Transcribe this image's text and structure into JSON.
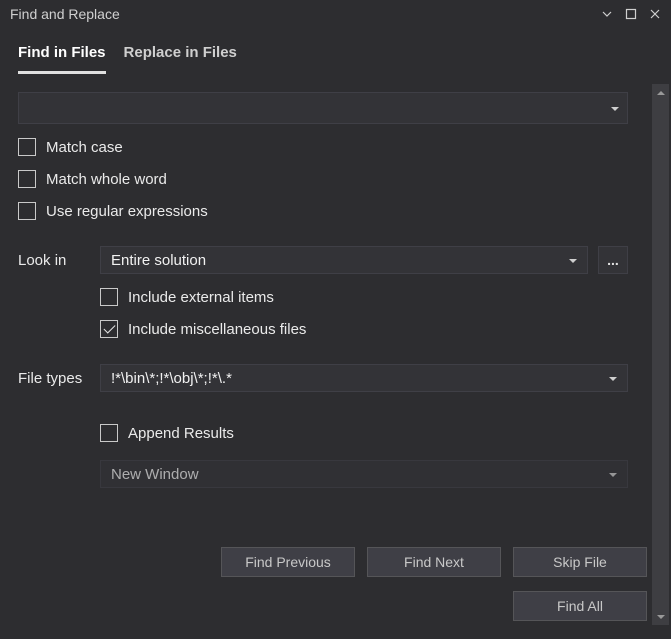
{
  "window": {
    "title": "Find and Replace"
  },
  "tabs": {
    "find": "Find in Files",
    "replace": "Replace in Files",
    "active": "find"
  },
  "search": {
    "value": ""
  },
  "options": {
    "match_case": "Match case",
    "match_whole_word": "Match whole word",
    "use_regex": "Use regular expressions"
  },
  "look_in": {
    "label": "Look in",
    "value": "Entire solution",
    "browse": "...",
    "include_external": "Include external items",
    "include_misc": "Include miscellaneous files",
    "include_misc_checked": true
  },
  "file_types": {
    "label": "File types",
    "value": "!*\\bin\\*;!*\\obj\\*;!*\\.*"
  },
  "results": {
    "append": "Append Results",
    "window": "New Window"
  },
  "buttons": {
    "find_previous": "Find Previous",
    "find_next": "Find Next",
    "skip_file": "Skip File",
    "find_all": "Find All"
  }
}
